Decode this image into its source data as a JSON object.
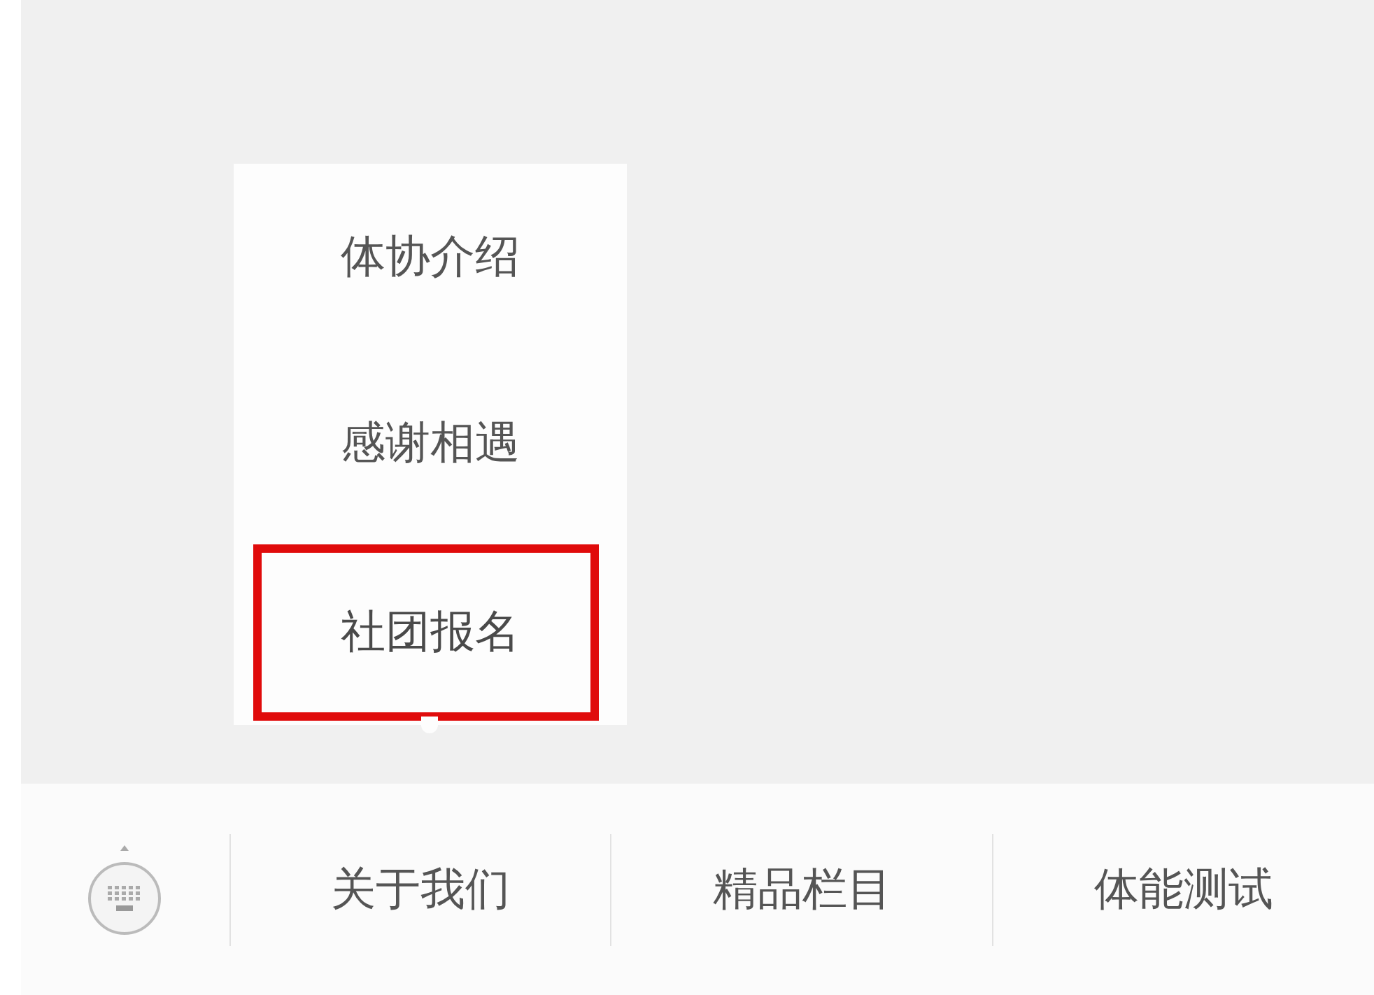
{
  "submenu": {
    "items": [
      {
        "label": "体协介绍",
        "highlighted": false
      },
      {
        "label": "感谢相遇",
        "highlighted": false
      },
      {
        "label": "社团报名",
        "highlighted": true
      }
    ]
  },
  "menu_bar": {
    "items": [
      {
        "label": "关于我们"
      },
      {
        "label": "精品栏目"
      },
      {
        "label": "体能测试"
      }
    ]
  }
}
